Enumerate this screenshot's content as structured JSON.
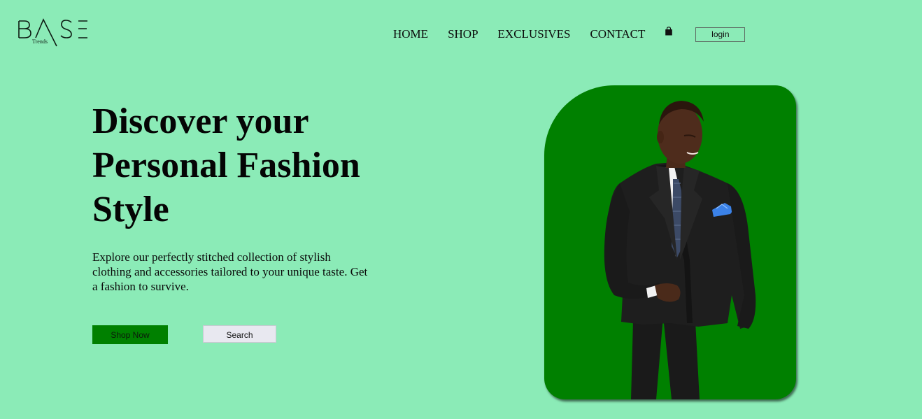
{
  "brand": {
    "name": "BASE",
    "tagline": "Trends"
  },
  "nav": {
    "links": [
      "HOME",
      "SHOP",
      "EXCLUSIVES",
      "CONTACT"
    ],
    "cart_icon": "shopping-bag-icon",
    "login_label": "login"
  },
  "hero": {
    "title": "Discover your Personal Fashion Style",
    "description": "Explore our perfectly stitched collection of stylish clothing and accessories tailored to your unique taste. Get a fashion to survive.",
    "shop_label": "Shop Now",
    "search_label": "Search"
  },
  "colors": {
    "background": "#8bebb7",
    "accent": "#008000"
  }
}
